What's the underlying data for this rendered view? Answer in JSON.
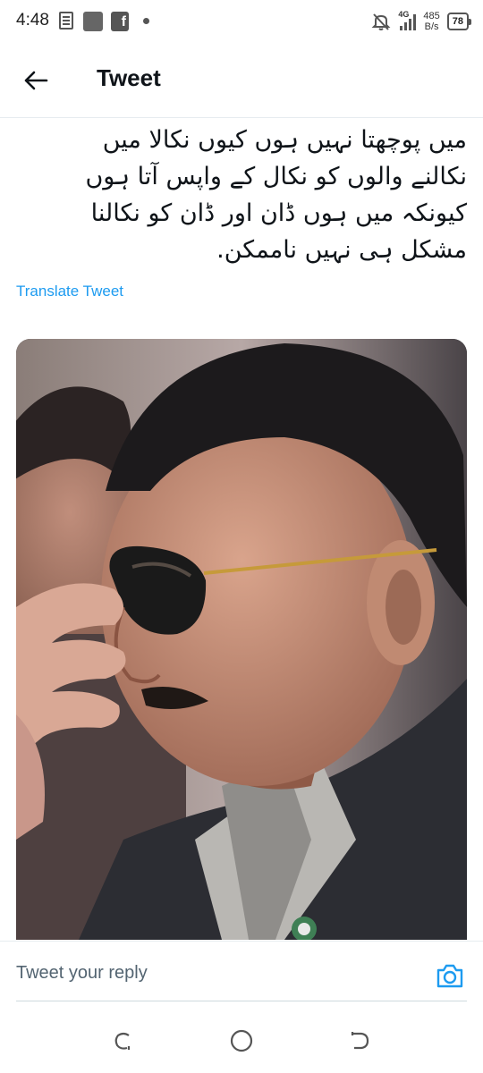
{
  "status_bar": {
    "time": "4:48",
    "network": "4G",
    "speed_value": "485",
    "speed_unit": "B/s",
    "battery": "78"
  },
  "header": {
    "title": "Tweet",
    "back_icon": "arrow-left-icon"
  },
  "tweet": {
    "text_lines": [
      "میں پوچھتا نہیں ہوں کیوں نکالا میں",
      "نکالنے والوں کو نکال کے واپس آتا ہوں",
      "کیونکہ میں ہوں ڈان اور ڈان کو نکالنا",
      "مشکل ہی نہیں ناممکن."
    ],
    "translate_label": "Translate Tweet"
  },
  "reply": {
    "placeholder": "Tweet your reply",
    "camera_icon": "camera-icon"
  },
  "nav": {
    "recents_icon": "recents-icon",
    "home_icon": "home-circle-icon",
    "back_icon": "nav-back-icon"
  },
  "colors": {
    "accent": "#1d9bf0",
    "text": "#0f1419",
    "muted": "#536471"
  }
}
